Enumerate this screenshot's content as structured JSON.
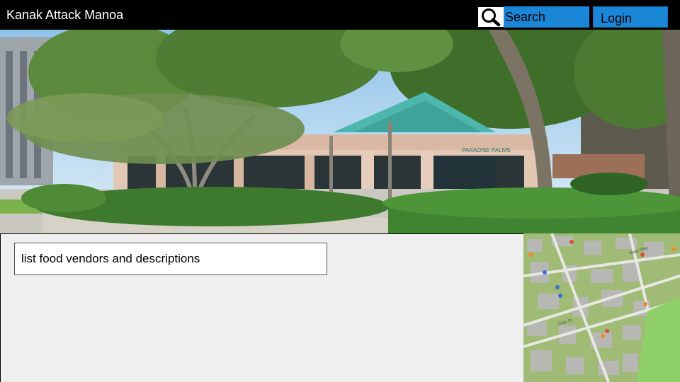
{
  "header": {
    "title": "Kanak Attack Manoa",
    "search_label": "Search",
    "login_label": "Login",
    "search_icon": "magnifier-icon"
  },
  "hero": {
    "sign_text": "PARADISE PALMS"
  },
  "content": {
    "textbox_text": "list food vendors and descriptions"
  },
  "map": {
    "road_labels": [
      "Dole St",
      "Maile Way"
    ]
  },
  "colors": {
    "header_bg": "#000000",
    "button_bg": "#1a86d8",
    "content_bg": "#efefef"
  }
}
